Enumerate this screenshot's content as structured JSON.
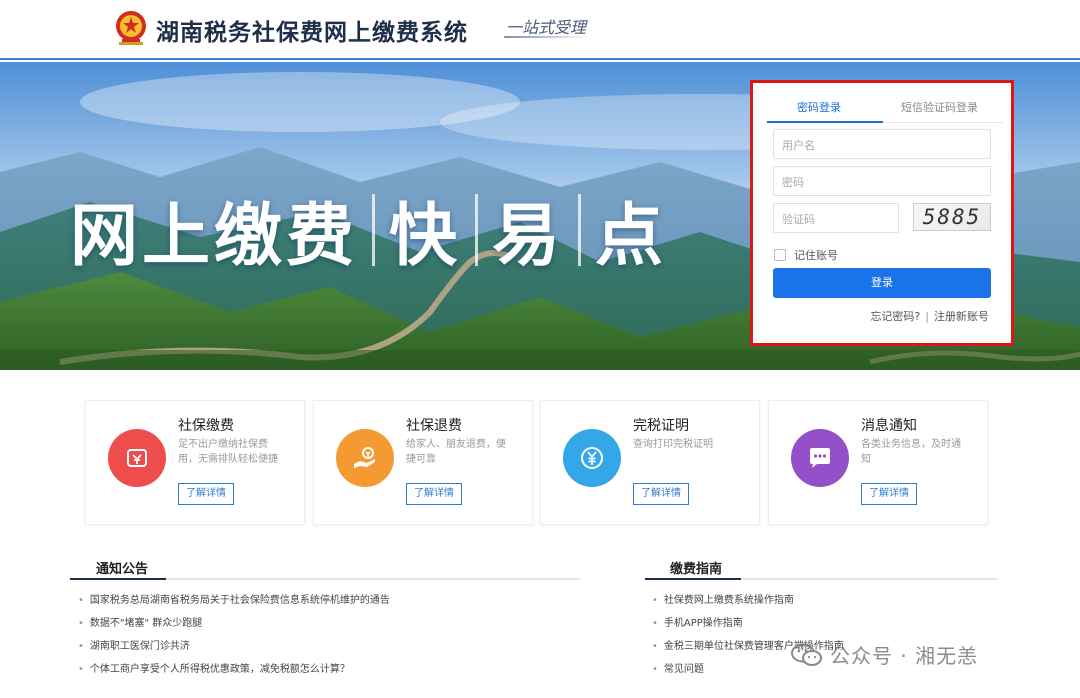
{
  "header": {
    "title": "湖南税务社保费网上缴费系统",
    "slogan": "一站式受理"
  },
  "banner": {
    "hero_words": [
      "网上缴费",
      "快",
      "易",
      "点"
    ]
  },
  "login": {
    "tabs": [
      {
        "label": "密码登录",
        "active": true
      },
      {
        "label": "短信验证码登录",
        "active": false
      }
    ],
    "username_placeholder": "用户名",
    "password_placeholder": "密码",
    "captcha_placeholder": "验证码",
    "captcha_code": "5885",
    "remember_label": "记住账号",
    "submit_label": "登录",
    "forgot_label": "忘记密码?",
    "register_label": "注册新账号",
    "frame_color": "#e01616",
    "button_color": "#1a73e8"
  },
  "services": [
    {
      "title": "社保缴费",
      "desc": "足不出户缴纳社保费用，无需排队轻松便捷",
      "button": "了解详情",
      "color": "#ef4c4c",
      "icon": "payment-icon"
    },
    {
      "title": "社保退费",
      "desc": "给家人、朋友退费，便捷可靠",
      "button": "了解详情",
      "color": "#f59a33",
      "icon": "refund-hand-icon"
    },
    {
      "title": "完税证明",
      "desc": "查询打印完税证明",
      "button": "了解详情",
      "color": "#33a7e8",
      "icon": "yuan-coin-icon"
    },
    {
      "title": "消息通知",
      "desc": "各类业务信息，及时通知",
      "button": "了解详情",
      "color": "#9350c8",
      "icon": "chat-bubble-icon"
    }
  ],
  "notices": {
    "title": "通知公告",
    "items": [
      "国家税务总局湖南省税务局关于社会保险费信息系统停机维护的通告",
      "数据不\"堵塞\" 群众少跑腿",
      "湖南职工医保门诊共济",
      "个体工商户享受个人所得税优惠政策，减免税额怎么计算？"
    ]
  },
  "guide": {
    "title": "缴费指南",
    "items": [
      "社保费网上缴费系统操作指南",
      "手机APP操作指南",
      "金税三期单位社保费管理客户端操作指南",
      "常见问题"
    ]
  },
  "watermark": {
    "text": "公众号 · 湘无恙"
  }
}
